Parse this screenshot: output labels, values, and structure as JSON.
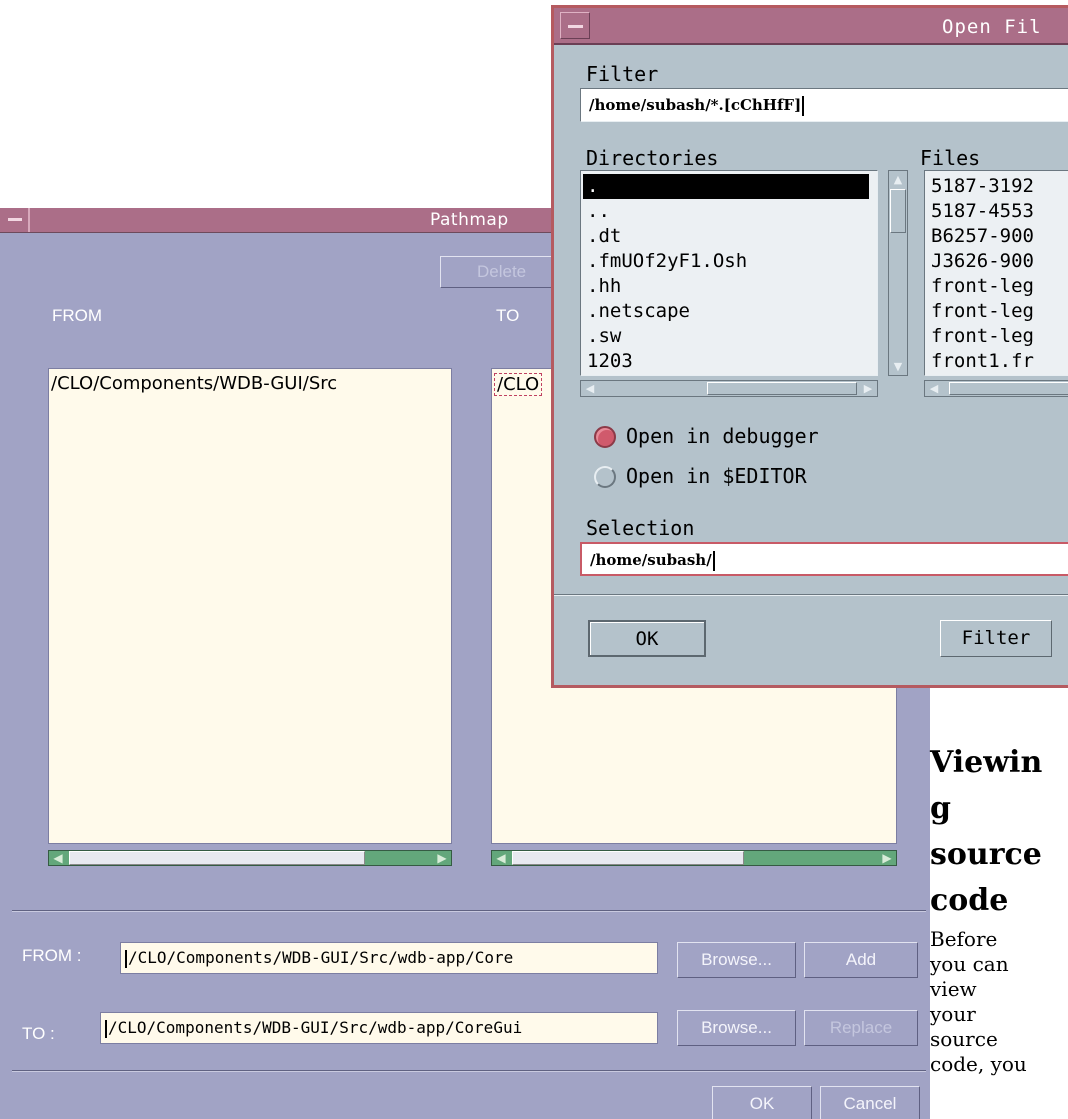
{
  "pathmap": {
    "title": "Pathmap",
    "delete_label": "Delete",
    "from_column_label": "FROM",
    "to_column_label": "TO",
    "from_list": {
      "items": [
        "/CLO/Components/WDB-GUI/Src"
      ]
    },
    "to_list": {
      "items": [
        "/CLO"
      ]
    },
    "from_field": {
      "label": "FROM :",
      "value": "/CLO/Components/WDB-GUI/Src/wdb-app/Core"
    },
    "to_field": {
      "label": "TO  :",
      "value": "/CLO/Components/WDB-GUI/Src/wdb-app/CoreGui"
    },
    "browse_from_label": "Browse...",
    "add_label": "Add",
    "browse_to_label": "Browse...",
    "replace_label": "Replace",
    "ok_label": "OK",
    "cancel_label": "Cancel"
  },
  "open_file_dialog": {
    "title": "Open Fil",
    "filter_label": "Filter",
    "filter_value": "/home/subash/*.[cChHfF]",
    "directories_label": "Directories",
    "directories": [
      ".",
      "..",
      ".dt",
      ".fmUOf2yF1.Osh",
      ".hh",
      ".netscape",
      ".sw",
      "1203"
    ],
    "selected_directory_index": 0,
    "files_label": "Files",
    "files": [
      "5187-3192",
      "5187-4553",
      "B6257-900",
      "J3626-900",
      "front-leg",
      "front-leg",
      "front-leg",
      "front1.fr"
    ],
    "radio_options": [
      {
        "label": "Open in debugger",
        "selected": true
      },
      {
        "label": "Open in $EDITOR",
        "selected": false
      }
    ],
    "selection_label": "Selection",
    "selection_value": "/home/subash/",
    "ok_label": "OK",
    "filter_button_label": "Filter"
  },
  "doc": {
    "heading_lines": [
      "Viewin",
      "g",
      "source",
      "code"
    ],
    "paragraph_lines": [
      "Before",
      "you can",
      "view",
      "your",
      "source",
      "code, you"
    ]
  },
  "colors": {
    "pathmap_bg": "#a1a3c5",
    "titlebar": "#ab6e88",
    "list_bg": "#fffaeb",
    "scrollbar_green": "#63a77b",
    "dialog_bg": "#b4c2cb",
    "dialog_border": "#b55a60",
    "radio_selected": "#d05a6c"
  },
  "icons": {
    "window_menu": "window-menu-icon",
    "scroll_left": "arrow-left-icon",
    "scroll_right": "arrow-right-icon",
    "scroll_up": "arrow-up-icon",
    "scroll_down": "arrow-down-icon"
  }
}
